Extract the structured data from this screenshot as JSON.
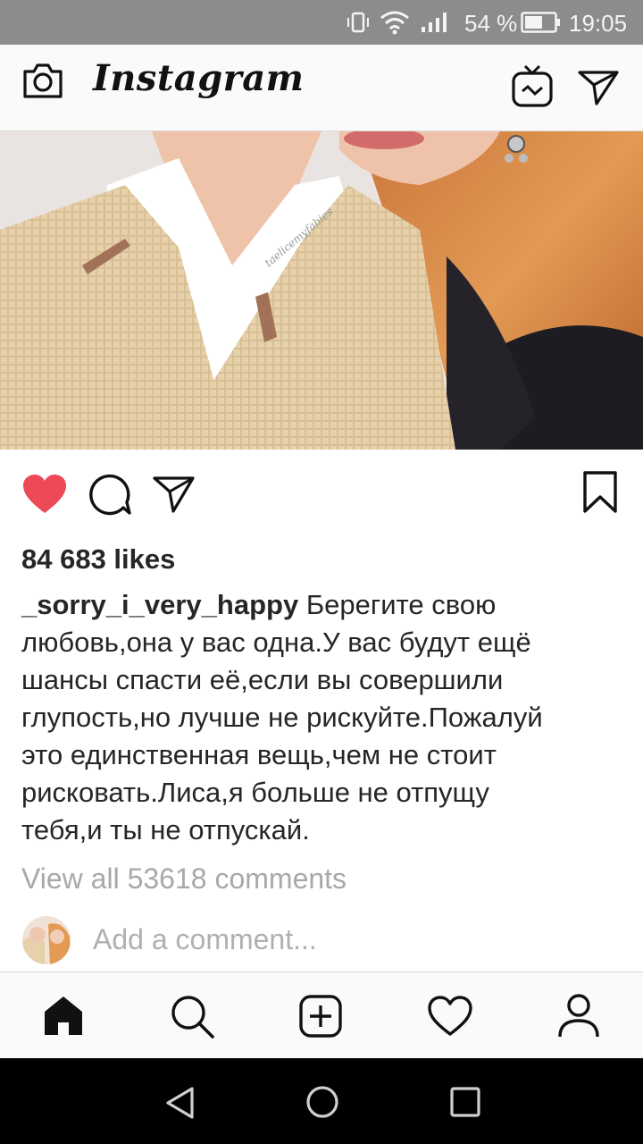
{
  "status_bar": {
    "battery": "54 %",
    "time": "19:05"
  },
  "header": {
    "logo": "Instagram"
  },
  "post": {
    "likes": "84 683 likes",
    "username": "_sorry_i_very_happy",
    "caption_lines": [
      " Берегите свою",
      "любовь,она у вас одна.У вас будут ещё",
      "шансы спасти её,если вы совершили",
      "глупость,но лучше не рискуйте.Пожалуй",
      "это единственная вещь,чем не стоит",
      "рисковать.Лиса,я больше не отпущу",
      "тебя,и ты не отпускай."
    ],
    "view_comments": "View all 53618 comments",
    "add_comment_placeholder": "Add a comment...",
    "liked": true,
    "watermark": "taelicemyfabies"
  },
  "colors": {
    "like_red": "#ed4956",
    "muted_text": "#a8a8a8"
  },
  "icons": [
    "camera-icon",
    "igtv-icon",
    "direct-icon",
    "heart-icon",
    "comment-icon",
    "share-icon",
    "bookmark-icon",
    "home-icon",
    "search-icon",
    "add-post-icon",
    "activity-heart-icon",
    "profile-icon",
    "back-icon",
    "home-circle-icon",
    "recents-icon"
  ]
}
